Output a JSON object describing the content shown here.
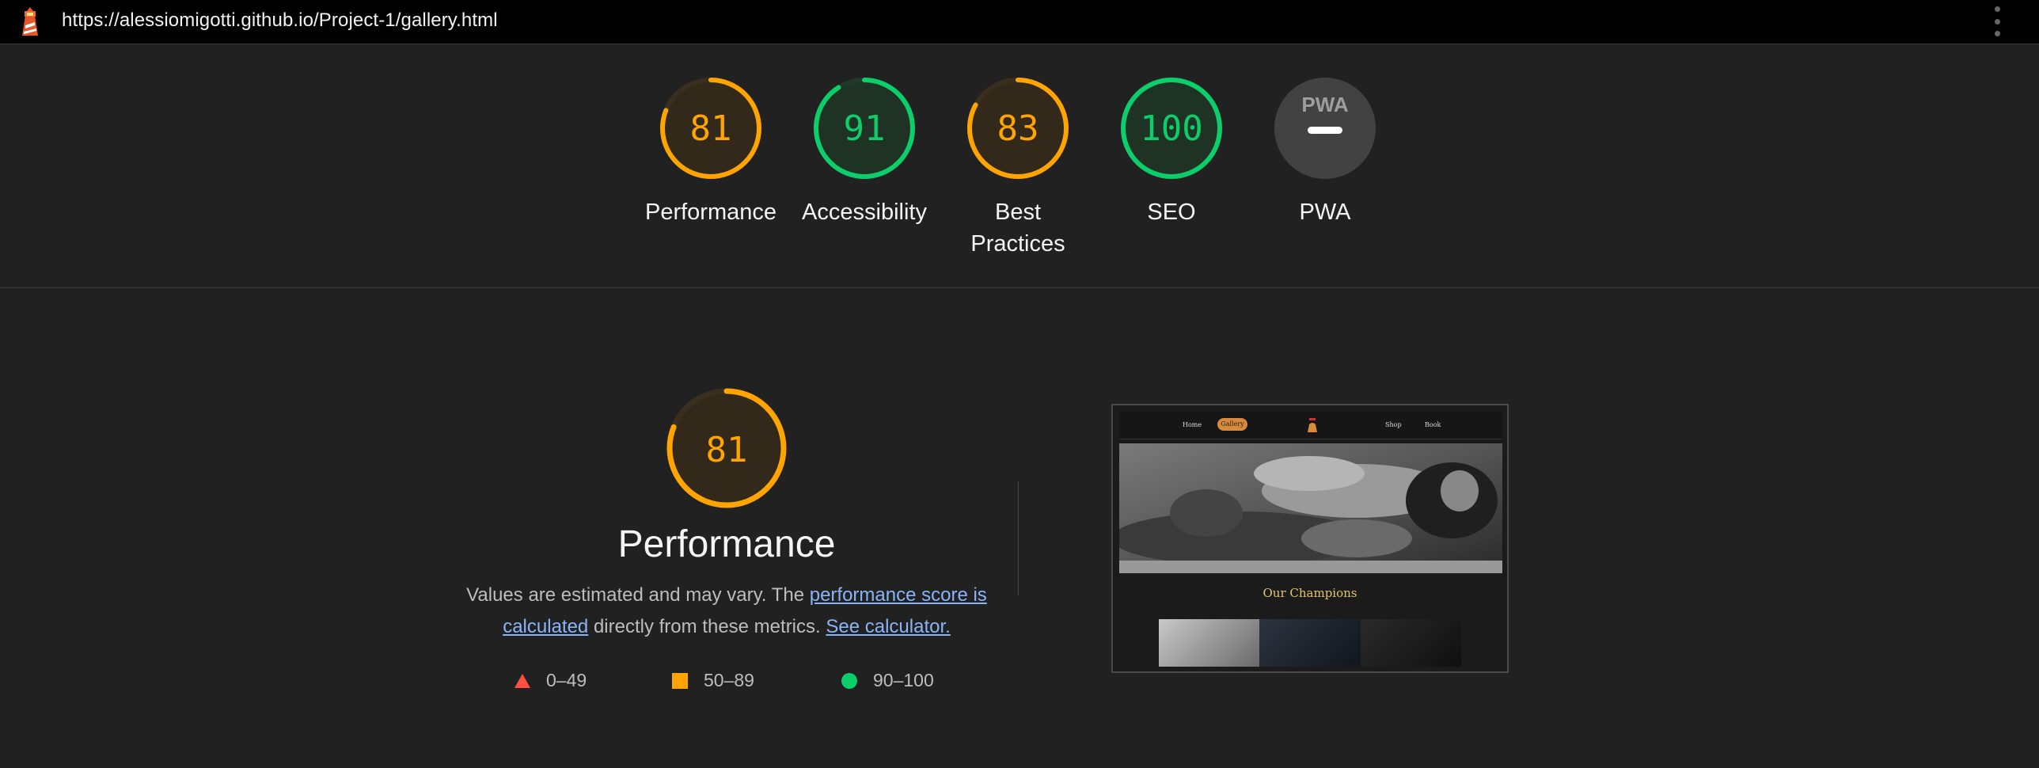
{
  "browser": {
    "url": "https://alessiomigotti.github.io/Project-1/gallery.html",
    "icon": "lighthouse-icon",
    "menu_icon": "kebab-menu-icon"
  },
  "colors": {
    "average": "#ffa400",
    "average_text": "#ffa400",
    "pass": "#0cce6b",
    "fail": "#ff4e42",
    "background": "#212121",
    "link": "#8ab4f8"
  },
  "scores": [
    {
      "label": "Performance",
      "score": "81",
      "value": 81,
      "status": "average"
    },
    {
      "label": "Accessibility",
      "score": "91",
      "value": 91,
      "status": "pass"
    },
    {
      "label": "Best Practices",
      "score": "83",
      "value": 83,
      "status": "average"
    },
    {
      "label": "SEO",
      "score": "100",
      "value": 100,
      "status": "pass"
    },
    {
      "label": "PWA",
      "score": "PWA",
      "status": "na",
      "icon": "pwa-badge-icon"
    }
  ],
  "performance": {
    "score": "81",
    "value": 81,
    "title": "Performance",
    "desc_prefix": "Values are estimated and may vary. The ",
    "desc_link1": "performance score is calculated",
    "desc_middle": " directly from these metrics. ",
    "desc_link2": "See calculator."
  },
  "legend": [
    {
      "range": "0–49",
      "icon": "triangle-icon"
    },
    {
      "range": "50–89",
      "icon": "square-icon"
    },
    {
      "range": "90–100",
      "icon": "circle-icon"
    }
  ],
  "screenshot": {
    "nav": [
      "Home",
      "Gallery",
      "Shop",
      "Book"
    ],
    "heading": "Our Champions"
  }
}
